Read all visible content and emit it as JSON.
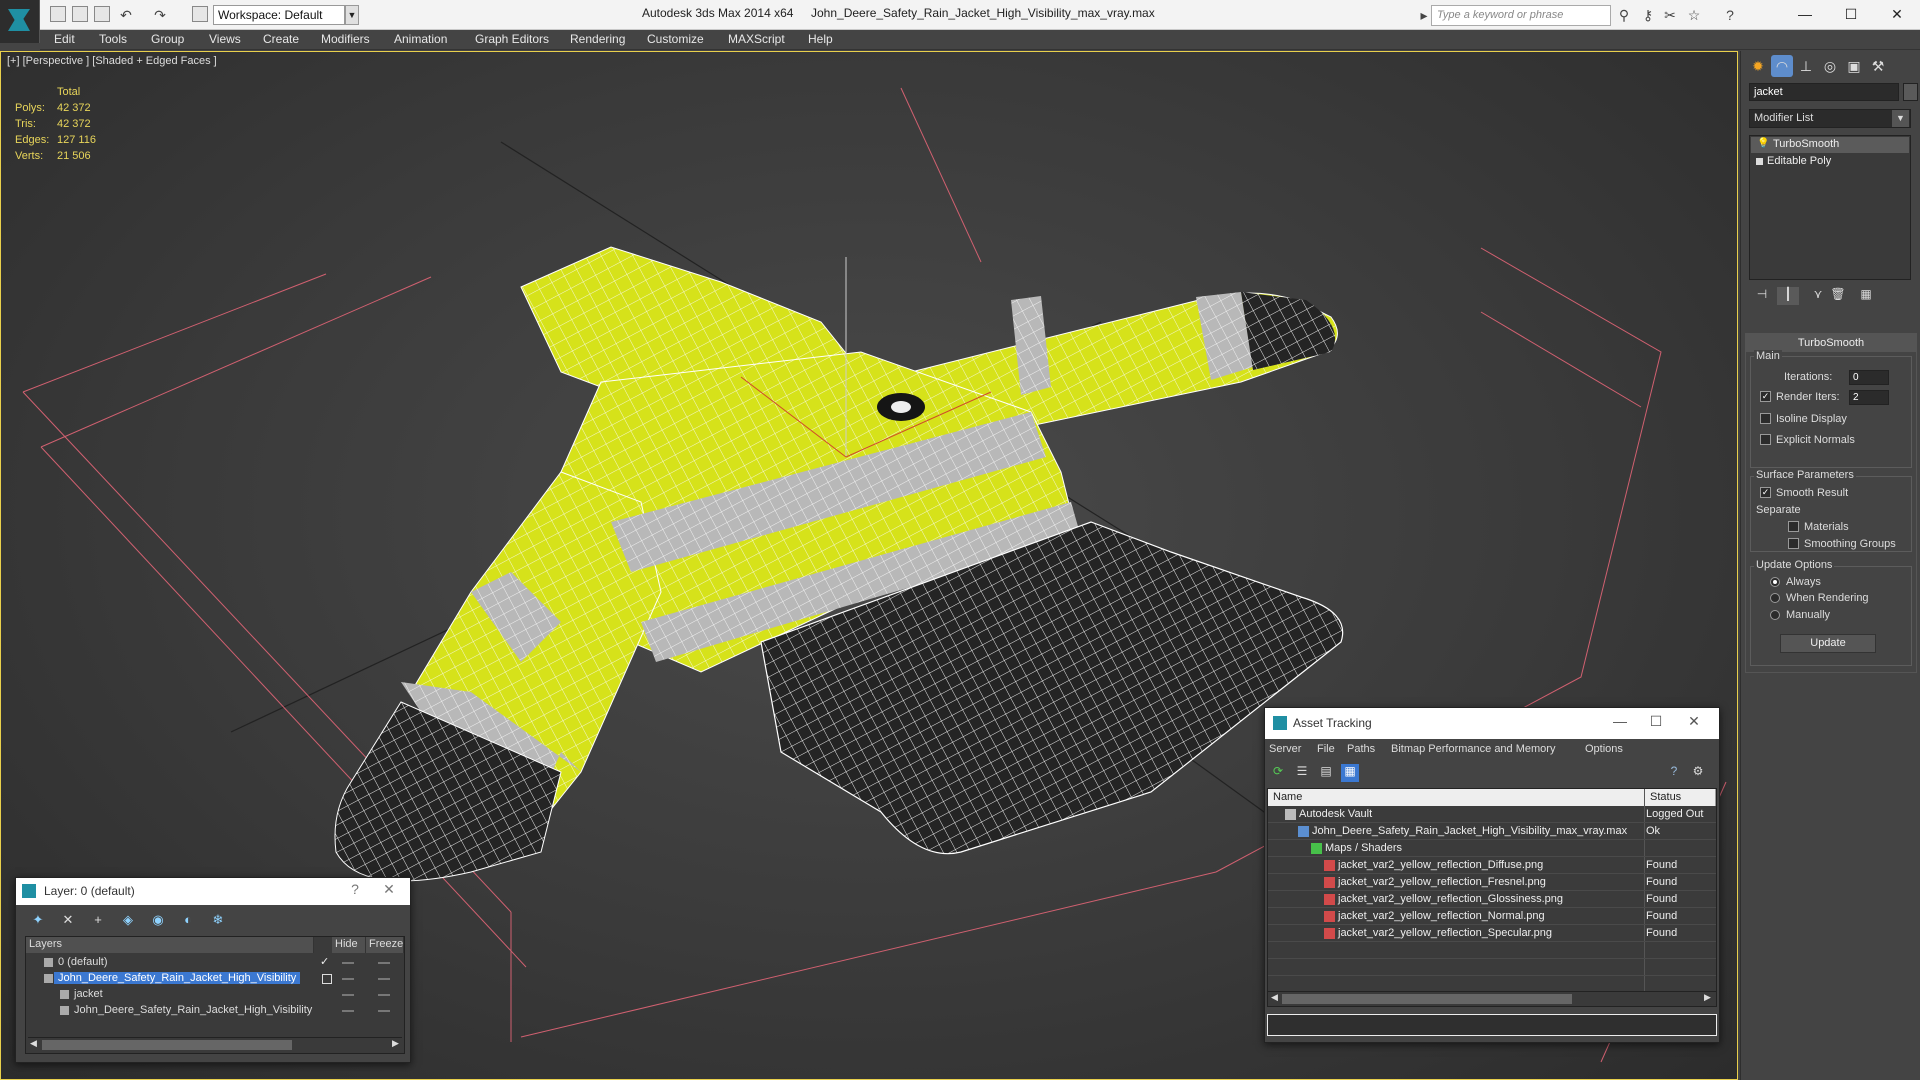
{
  "titlebar": {
    "workspace": "Workspace: Default",
    "app_title": "Autodesk 3ds Max  2014 x64",
    "file_title": "John_Deere_Safety_Rain_Jacket_High_Visibility_max_vray.max",
    "search_placeholder": "Type a keyword or phrase"
  },
  "menu": [
    "Edit",
    "Tools",
    "Group",
    "Views",
    "Create",
    "Modifiers",
    "Animation",
    "Graph Editors",
    "Rendering",
    "Customize",
    "MAXScript",
    "Help"
  ],
  "viewport": {
    "label": "[+] [Perspective ] [Shaded + Edged Faces ]",
    "stats_header": "Total",
    "stats": [
      {
        "k": "Polys:",
        "v": "42 372"
      },
      {
        "k": "Tris:",
        "v": "42 372"
      },
      {
        "k": "Edges:",
        "v": "127 116"
      },
      {
        "k": "Verts:",
        "v": "21 506"
      }
    ],
    "colors": {
      "jacket_yellow": "#d6e21a",
      "reflective_band": "#b8b8b8",
      "dark_fabric": "#262626",
      "grid_lines": "#d06070",
      "viewport_border": "#e9d04c"
    }
  },
  "command_panel": {
    "object_name": "jacket",
    "modifier_list": "Modifier List",
    "stack": [
      "TurboSmooth",
      "Editable Poly"
    ],
    "turbosmooth": {
      "title": "TurboSmooth",
      "main": "Main",
      "iterations_label": "Iterations:",
      "iterations": "0",
      "render_iters_label": "Render Iters:",
      "render_iters": "2",
      "isoline": "Isoline Display",
      "explicit_normals": "Explicit Normals",
      "surface_params": "Surface Parameters",
      "smooth_result": "Smooth Result",
      "separate": "Separate",
      "materials": "Materials",
      "smoothing_groups": "Smoothing Groups",
      "update_options": "Update Options",
      "always": "Always",
      "when_rendering": "When Rendering",
      "manually": "Manually",
      "update": "Update"
    }
  },
  "layer_window": {
    "title": "Layer: 0 (default)",
    "help": "?",
    "close": "✕",
    "columns": {
      "layers": "Layers",
      "hide": "Hide",
      "freeze": "Freeze"
    },
    "rows": [
      {
        "name": "0 (default)",
        "indent": 0,
        "selected": false,
        "checked": true
      },
      {
        "name": "John_Deere_Safety_Rain_Jacket_High_Visibility",
        "indent": 0,
        "selected": true,
        "checked": false
      },
      {
        "name": "jacket",
        "indent": 1,
        "selected": false,
        "checked": false
      },
      {
        "name": "John_Deere_Safety_Rain_Jacket_High_Visibility",
        "indent": 1,
        "selected": false,
        "checked": false
      }
    ]
  },
  "asset_window": {
    "title": "Asset Tracking",
    "menu": [
      "Server",
      "File",
      "Paths",
      "Bitmap Performance and Memory",
      "Options"
    ],
    "columns": {
      "name": "Name",
      "status": "Status"
    },
    "rows": [
      {
        "name": "Autodesk Vault",
        "status": "Logged Out",
        "indent": 1,
        "icon": "vault-icon"
      },
      {
        "name": "John_Deere_Safety_Rain_Jacket_High_Visibility_max_vray.max",
        "status": "Ok",
        "indent": 2,
        "icon": "max-file-icon"
      },
      {
        "name": "Maps / Shaders",
        "status": "",
        "indent": 3,
        "icon": "folder-icon"
      },
      {
        "name": "jacket_var2_yellow_reflection_Diffuse.png",
        "status": "Found",
        "indent": 4,
        "icon": "png-icon"
      },
      {
        "name": "jacket_var2_yellow_reflection_Fresnel.png",
        "status": "Found",
        "indent": 4,
        "icon": "png-icon"
      },
      {
        "name": "jacket_var2_yellow_reflection_Glossiness.png",
        "status": "Found",
        "indent": 4,
        "icon": "png-icon"
      },
      {
        "name": "jacket_var2_yellow_reflection_Normal.png",
        "status": "Found",
        "indent": 4,
        "icon": "png-icon"
      },
      {
        "name": "jacket_var2_yellow_reflection_Specular.png",
        "status": "Found",
        "indent": 4,
        "icon": "png-icon"
      }
    ]
  }
}
